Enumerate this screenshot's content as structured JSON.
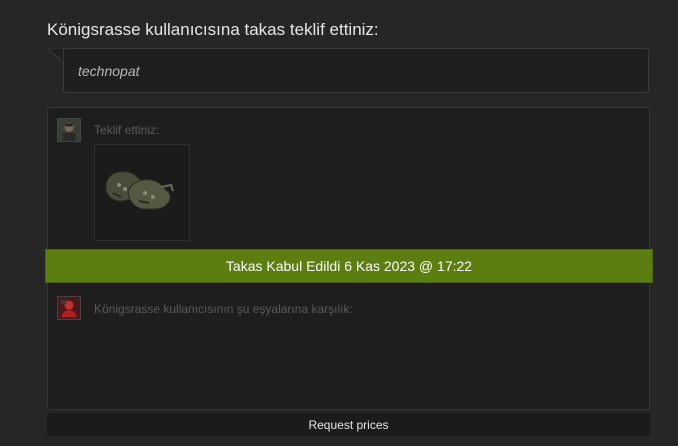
{
  "heading": "Königsrasse kullanıcısına takas teklif ettiniz:",
  "message": "technopat",
  "trade": {
    "your_offer_label": "Teklif ettiniz:",
    "partner_offer_label": "Königsrasse kullanıcısının şu eşyalarına karşılık:",
    "your_items": [
      {
        "icon": "gloves-item-icon"
      }
    ],
    "status": "Takas Kabul Edildi 6 Kas 2023 @ 17:22",
    "status_color": "#5c7e10"
  },
  "request_prices_label": "Request prices",
  "colors": {
    "background": "#262626",
    "panel": "#1e1e1e",
    "accent_green": "#5c7e10"
  }
}
